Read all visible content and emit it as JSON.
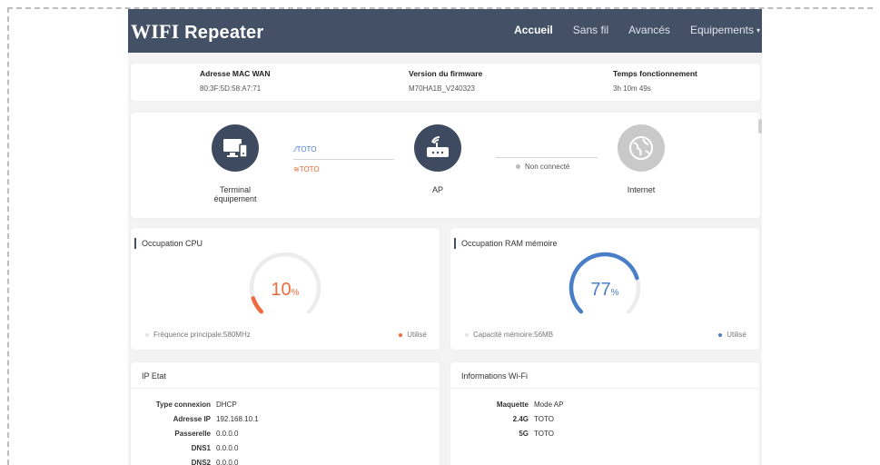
{
  "brand": {
    "prefix": "WIFI",
    "suffix": "Repeater"
  },
  "nav": {
    "items": [
      "Accueil",
      "Sans fil",
      "Avancés",
      "Equipements"
    ],
    "dropdown_caret": "▾"
  },
  "info": {
    "mac_label": "Adresse MAC WAN",
    "mac_value": "80:3F:5D:58:A7:71",
    "fw_label": "Version du firmware",
    "fw_value": "M70HA1B_V240323",
    "uptime_label": "Temps fonctionnement",
    "uptime_value": "3h 10m 49s"
  },
  "topology": {
    "terminal_label_line1": "Terminal",
    "terminal_label_line2": "équipement",
    "ssid_5g": "TOTO",
    "ssid_24g": "TOTO",
    "ap_label": "AP",
    "status_text": "Non connecté",
    "internet_label": "Internet"
  },
  "cpu": {
    "title": "Occupation CPU",
    "value": 10,
    "unit": "%",
    "footer_left": "Fréquence principale:580MHz",
    "footer_right": "Utilisé",
    "color": "#f06b3c"
  },
  "ram": {
    "title": "Occupation RAM mémoire",
    "value": 77,
    "unit": "%",
    "footer_left": "Capacité mémoire:56MB",
    "footer_right": "Utilisé",
    "color": "#4a7fc8"
  },
  "ip": {
    "title": "IP Etat",
    "rows": [
      {
        "k": "Type connexion",
        "v": "DHCP"
      },
      {
        "k": "Adresse IP",
        "v": "192.168.10.1"
      },
      {
        "k": "Passerelle",
        "v": "0.0.0.0"
      },
      {
        "k": "DNS1",
        "v": "0.0.0.0"
      },
      {
        "k": "DNS2",
        "v": "0.0.0.0"
      }
    ]
  },
  "wifi": {
    "title": "Informations Wi-Fi",
    "rows": [
      {
        "k": "Maquette",
        "v": "Mode AP"
      },
      {
        "k": "2.4G",
        "v": "TOTO"
      },
      {
        "k": "5G",
        "v": "TOTO"
      }
    ]
  }
}
